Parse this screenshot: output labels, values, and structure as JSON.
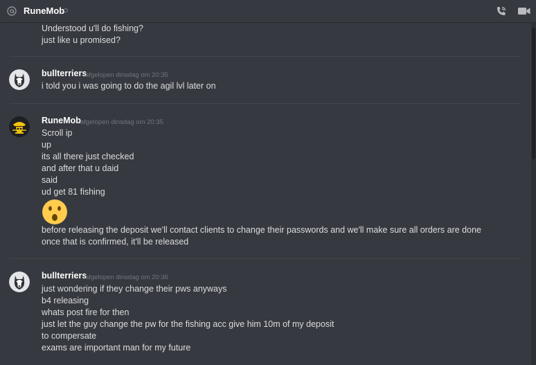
{
  "header": {
    "channel_name": "RuneMob",
    "icons": [
      "at-icon",
      "status-dot",
      "phone-call-icon",
      "video-call-icon"
    ]
  },
  "messages": [
    {
      "continuation": true,
      "lines": [
        "Understood u'll do fishing?",
        "just like u promised?"
      ]
    },
    {
      "author": "bullterriers",
      "timestamp": "afgelopen dinsdag om 20:35",
      "avatar": "bull-terrier-avatar",
      "lines": [
        "i told you i was going to do the agil lvl later on"
      ]
    },
    {
      "author": "RuneMob",
      "timestamp": "afgelopen dinsdag om 20:35",
      "avatar": "runemob-pirate-avatar",
      "lines": [
        "Scroll ip",
        "up",
        "its all there just checked",
        "and after that u daid",
        "said",
        "ud get 81 fishing"
      ],
      "emoji": "astonished-face-emoji",
      "lines_after": [
        "before releasing the deposit we'll contact clients to change their passwords and we'll make sure all orders are done",
        "once that is confirmed, it'll be released"
      ]
    },
    {
      "author": "bullterriers",
      "timestamp": "afgelopen dinsdag om 20:36",
      "avatar": "bull-terrier-avatar",
      "lines": [
        "just wondering if they change their pws anyways",
        "b4 releasing",
        "whats post fire for then",
        "just let the guy change the pw for the fishing acc give him 10m of my deposit",
        "to compersate",
        "exams are important man for my future"
      ]
    }
  ],
  "colors": {
    "background": "#36393f",
    "text": "#dcddde",
    "username": "#ffffff",
    "timestamp": "#72767d",
    "divider": "#42454a",
    "emoji_yellow": "#ffcc4d"
  }
}
